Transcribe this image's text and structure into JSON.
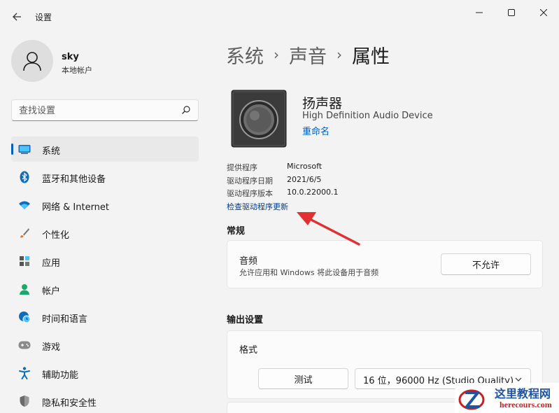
{
  "window": {
    "title": "设置",
    "back_icon": "arrow-left-icon",
    "controls": [
      "minimize-icon",
      "maximize-icon",
      "close-icon"
    ]
  },
  "profile": {
    "name": "sky",
    "account_type": "本地帐户"
  },
  "search": {
    "placeholder": "查找设置"
  },
  "sidebar": {
    "items": [
      {
        "label": "系统",
        "icon": "monitor-icon",
        "active": true
      },
      {
        "label": "蓝牙和其他设备",
        "icon": "bluetooth-icon"
      },
      {
        "label": "网络 & Internet",
        "icon": "wifi-icon"
      },
      {
        "label": "个性化",
        "icon": "brush-icon"
      },
      {
        "label": "应用",
        "icon": "apps-icon"
      },
      {
        "label": "帐户",
        "icon": "person-icon"
      },
      {
        "label": "时间和语言",
        "icon": "clock-globe-icon"
      },
      {
        "label": "游戏",
        "icon": "gamepad-icon"
      },
      {
        "label": "辅助功能",
        "icon": "accessibility-icon"
      },
      {
        "label": "隐私和安全性",
        "icon": "shield-icon"
      }
    ]
  },
  "breadcrumb": {
    "items": [
      "系统",
      "声音",
      "属性"
    ],
    "separator": "›"
  },
  "device": {
    "icon": "speaker-icon",
    "name": "扬声器",
    "description": "High Definition Audio Device",
    "rename_link": "重命名"
  },
  "driver_info": {
    "provider_label": "提供程序",
    "provider_value": "Microsoft",
    "date_label": "驱动程序日期",
    "date_value": "2021/6/5",
    "version_label": "驱动程序版本",
    "version_value": "10.0.22000.1",
    "update_link": "检查驱动程序更新"
  },
  "general": {
    "section_title": "常规",
    "audio_title": "音频",
    "audio_description": "允许应用和 Windows 将此设备用于音频",
    "disallow_button": "不允许"
  },
  "output": {
    "section_title": "输出设置",
    "format_title": "格式",
    "test_button": "测试",
    "format_value": "16 位，96000 Hz (Studio Quality)"
  },
  "watermark": {
    "text_cn": "这里教程网",
    "text_en": "herecours.com"
  },
  "colors": {
    "accent": "#005fb8",
    "link": "#005fb8",
    "annotation_arrow": "#e03030",
    "background": "#f3f3f3",
    "card": "#fbfbfb"
  }
}
